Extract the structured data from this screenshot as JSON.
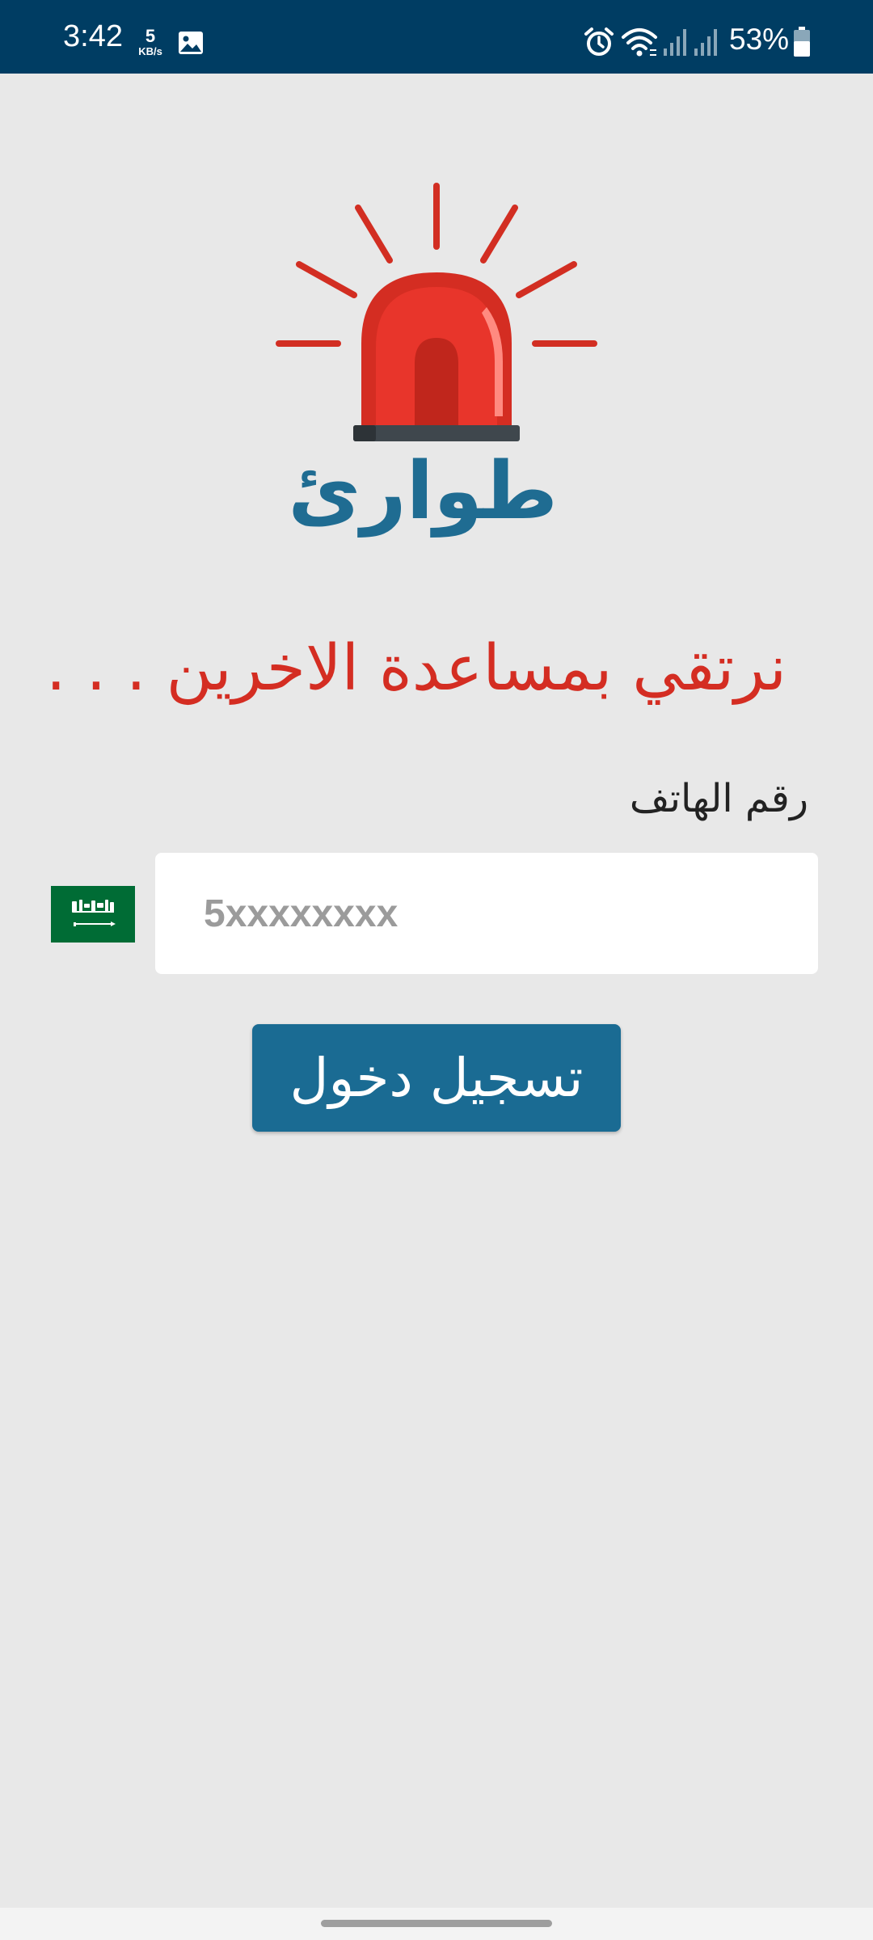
{
  "status_bar": {
    "time": "3:42",
    "net_speed_value": "5",
    "net_speed_unit": "KB/s",
    "battery_percent": "53%",
    "icons": [
      "image-icon",
      "alarm-icon",
      "wifi-icon",
      "signal-icon",
      "signal-icon",
      "battery-icon"
    ]
  },
  "app": {
    "name": "طوارئ",
    "logo_icon": "siren-icon",
    "tagline": "نرتقي بمساعدة الاخرين . . ."
  },
  "login_form": {
    "phone_label": "رقم الهاتف",
    "phone_placeholder": "5xxxxxxxx",
    "phone_value": "",
    "country_flag": "saudi-flag-icon",
    "submit_label": "تسجيل دخول"
  },
  "colors": {
    "status_bar": "#003d63",
    "background": "#e8e8e8",
    "brand_blue": "#1a6b93",
    "accent_red": "#d42d22",
    "flag_green": "#006c35"
  }
}
